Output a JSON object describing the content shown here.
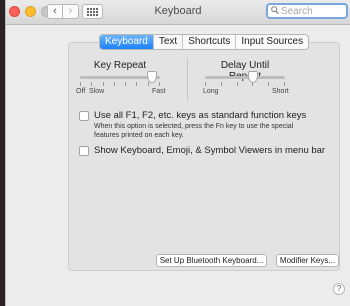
{
  "window": {
    "title": "Keyboard"
  },
  "toolbar": {
    "back_glyph": "‹",
    "forward_glyph": "›"
  },
  "search": {
    "placeholder": "Search",
    "value": ""
  },
  "tabs": [
    {
      "label": "Keyboard",
      "active": true
    },
    {
      "label": "Text",
      "active": false
    },
    {
      "label": "Shortcuts",
      "active": false
    },
    {
      "label": "Input Sources",
      "active": false
    }
  ],
  "key_repeat": {
    "label": "Key Repeat",
    "min_label": "Off",
    "slow_label": "Slow",
    "max_label": "Fast",
    "value_fraction": 0.9
  },
  "delay_until_repeat": {
    "label": "Delay Until Repeat",
    "min_label": "Long",
    "max_label": "Short",
    "value_fraction": 0.6
  },
  "options": {
    "function_keys": {
      "label": "Use all F1, F2, etc. keys as standard function keys",
      "note": "When this option is selected, press the Fn key to use the special features printed on each key.",
      "checked": false
    },
    "viewers": {
      "label": "Show Keyboard, Emoji, & Symbol Viewers in menu bar",
      "checked": false
    }
  },
  "buttons": {
    "bluetooth": "Set Up Bluetooth Keyboard...",
    "modifier": "Modifier Keys..."
  },
  "help": {
    "glyph": "?"
  },
  "colors": {
    "accent": "#1a82fb",
    "close": "#fc5f57",
    "minimize": "#fdbc2e"
  }
}
